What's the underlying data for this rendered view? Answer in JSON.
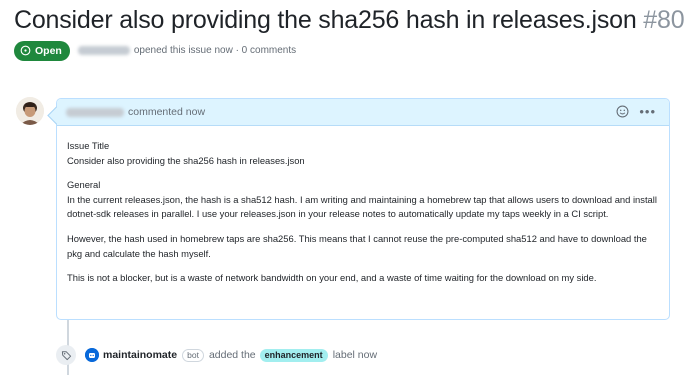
{
  "issue": {
    "title": "Consider also providing the sha256 hash in releases.json",
    "number": "#80",
    "state": "Open",
    "meta": "opened this issue now · 0 comments"
  },
  "comment": {
    "header_text": "commented now",
    "paragraphs": [
      "Issue Title\nConsider also providing the sha256 hash in releases.json",
      "General\nIn the current releases.json, the hash is a sha512 hash. I am writing and maintaining a homebrew tap that allows users to download and install dotnet-sdk releases in parallel. I use your releases.json in your release notes to automatically update my taps weekly in a CI script.",
      "However, the hash used in homebrew taps are sha256. This means that I cannot reuse the pre-computed sha512 and have to download the pkg and calculate the hash myself.",
      "This is not a blocker, but is a waste of network bandwidth on your end, and a waste of time waiting for the download on my side."
    ]
  },
  "event": {
    "actor": "maintainomate",
    "bot_badge": "bot",
    "action_before": "added the",
    "label": "enhancement",
    "action_after": "label now"
  },
  "icons": {
    "state": "issue-opened-icon",
    "smiley": "smiley-icon",
    "menu": "kebab-horizontal-icon",
    "tag": "tag-icon"
  },
  "colors": {
    "open_green": "#1f883d",
    "header_blue": "#ddf4ff",
    "label_cyan": "#a2eeef",
    "muted": "#656d76"
  }
}
